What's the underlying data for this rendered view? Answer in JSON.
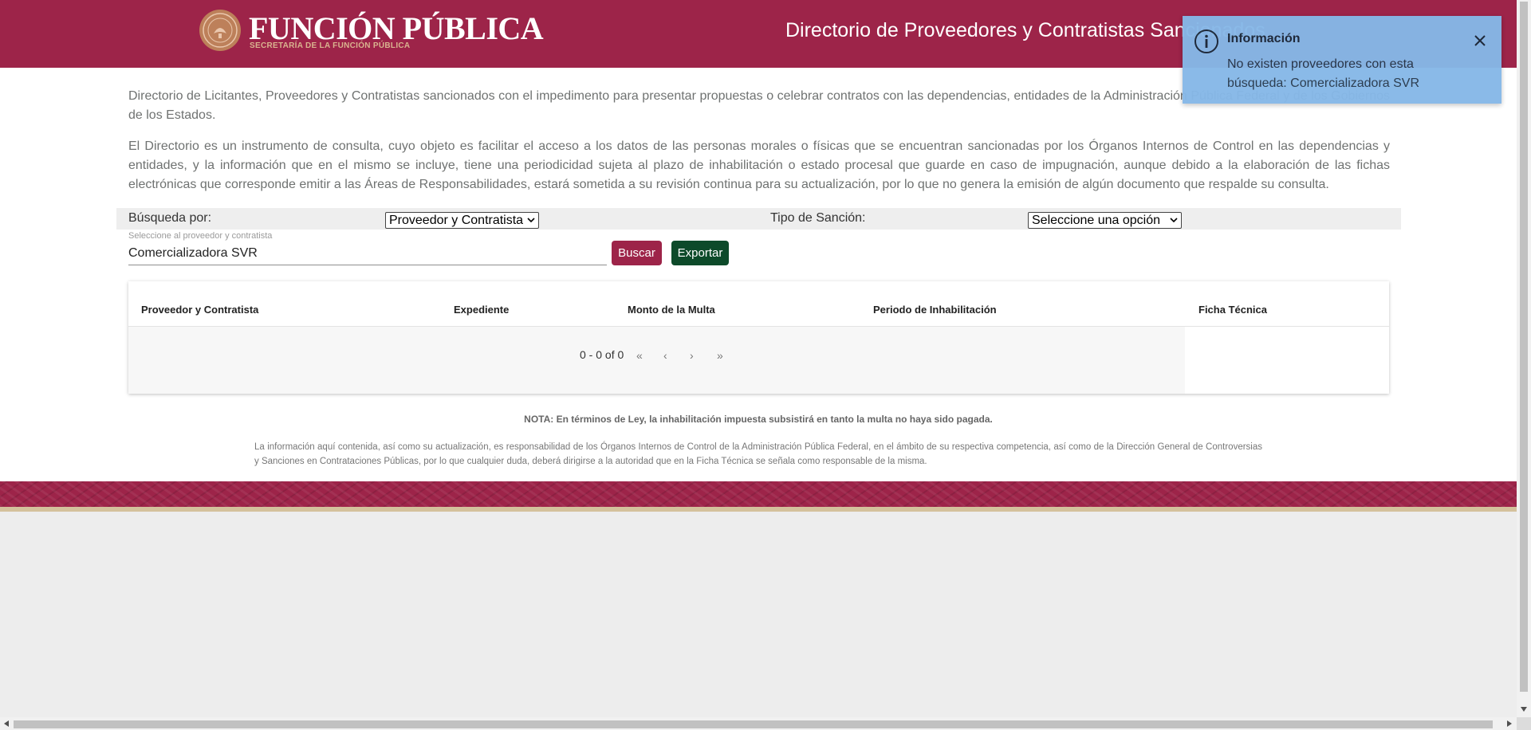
{
  "header": {
    "logo_title": "FUNCIÓN PÚBLICA",
    "logo_subtitle": "SECRETARÍA DE LA FUNCIÓN PÚBLICA",
    "title": "Directorio de Proveedores y Contratistas Sancionados"
  },
  "intro": {
    "paragraph1": "Directorio de Licitantes, Proveedores y Contratistas sancionados con el impedimento para presentar propuestas o celebrar contratos con las dependencias, entidades de la Administración Pública Federal y de los Gobiernos de los Estados.",
    "paragraph2": "El Directorio es un instrumento de consulta, cuyo objeto es facilitar el acceso a los datos de las personas morales o físicas que se encuentran sancionadas por los Órganos Internos de Control en las dependencias y entidades, y la información que en el mismo se incluye, tiene una periodicidad sujeta al plazo de inhabilitación o estado procesal que guarde en caso de impugnación, aunque debido a la elaboración de las fichas electrónicas que corresponde emitir a las Áreas de Responsabilidades, estará sometida a su revisión continua para su actualización, por lo que no genera la emisión de algún documento que respalde su consulta."
  },
  "filters": {
    "busqueda_label": "Búsqueda por:",
    "busqueda_value": "Proveedor y Contratista",
    "tipo_label": "Tipo de Sanción:",
    "tipo_value": "Seleccione una opción"
  },
  "search": {
    "label": "Seleccione al proveedor y contratista",
    "value": "Comercializadora SVR",
    "buscar_label": "Buscar",
    "exportar_label": "Exportar",
    "buscar_color": "#9d2449",
    "exportar_color": "#0d4a2a"
  },
  "table": {
    "columns": [
      "Proveedor y Contratista",
      "Expediente",
      "Monto de la Multa",
      "Periodo de Inhabilitación",
      "Ficha Técnica"
    ],
    "rows": [],
    "pagination": {
      "range": "0 - 0 of 0",
      "first": "«",
      "prev": "‹",
      "next": "›",
      "last": "»"
    }
  },
  "footer": {
    "nota_prefix": "NOTA:",
    "nota_text": " En términos de Ley, la inhabilitación impuesta subsistirá en tanto la multa no haya sido pagada.",
    "disclaimer": "La información aquí contenida, así como su actualización, es responsabilidad de los Órganos Internos de Control de la Administración Pública Federal, en el ámbito de su respectiva competencia, así como de la Dirección General de Controversias y Sanciones en Contrataciones Públicas, por lo que cualquier duda, deberá dirigirse a la autoridad que en la Ficha Técnica se señala como responsable de la misma."
  },
  "toast": {
    "title": "Información",
    "message": "No existen proveedores con esta búsqueda: Comercializadora SVR",
    "icon": "info-icon",
    "close_icon": "close-icon",
    "background": "#86b8e8"
  },
  "theme": {
    "brand": "#9d2449",
    "accent_gold": "#d4c19c"
  }
}
